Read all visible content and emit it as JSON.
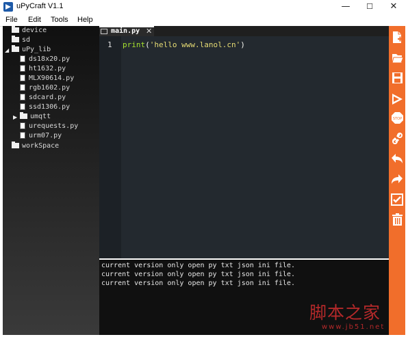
{
  "window": {
    "title": "uPyCraft V1.1",
    "minimize": "—",
    "maximize": "☐",
    "close": "✕"
  },
  "menu": [
    "File",
    "Edit",
    "Tools",
    "Help"
  ],
  "tree": {
    "device": "device",
    "sd": "sd",
    "upy_lib": "uPy_lib",
    "files": [
      "ds18x20.py",
      "ht1632.py",
      "MLX90614.py",
      "rgb1602.py",
      "sdcard.py",
      "ssd1306.py"
    ],
    "umqtt": "umqtt",
    "more_files": [
      "urequests.py",
      "urm07.py"
    ],
    "workspace": "workSpace"
  },
  "editor": {
    "tab_label": "main.py",
    "line_number": "1",
    "code": {
      "fn": "print",
      "open": "(",
      "str": "'hello www.lanol.cn'",
      "close": ")"
    }
  },
  "console": {
    "lines": [
      "current version only open py txt json ini file.",
      "current version only open py txt json ini file.",
      "current version only open py txt json ini file."
    ]
  },
  "toolbar": [
    "new-file-icon",
    "open-file-icon",
    "save-icon",
    "run-icon",
    "stop-icon",
    "connect-icon",
    "undo-icon",
    "redo-icon",
    "syntax-check-icon",
    "clear-icon"
  ],
  "watermark": {
    "main": "脚本之家",
    "sub": "www.jb51.net"
  }
}
